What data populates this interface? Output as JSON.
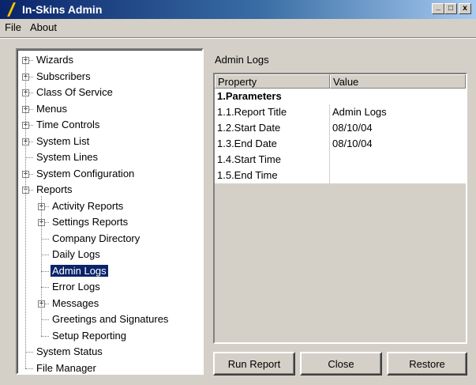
{
  "window": {
    "title": "In-Skins Admin"
  },
  "titlebar_buttons": {
    "minimize": "_",
    "maximize": "□",
    "close": "x"
  },
  "menu": [
    "File",
    "About"
  ],
  "tree": [
    {
      "label": "Wizards",
      "level": 0,
      "expander": "+"
    },
    {
      "label": "Subscribers",
      "level": 0,
      "expander": "+"
    },
    {
      "label": "Class Of Service",
      "level": 0,
      "expander": "+"
    },
    {
      "label": "Menus",
      "level": 0,
      "expander": "+"
    },
    {
      "label": "Time Controls",
      "level": 0,
      "expander": "+"
    },
    {
      "label": "System List",
      "level": 0,
      "expander": "+"
    },
    {
      "label": "System Lines",
      "level": 0,
      "expander": ""
    },
    {
      "label": "System Configuration",
      "level": 0,
      "expander": "+"
    },
    {
      "label": "Reports",
      "level": 0,
      "expander": "-"
    },
    {
      "label": "Activity Reports",
      "level": 1,
      "expander": "+"
    },
    {
      "label": "Settings Reports",
      "level": 1,
      "expander": "+"
    },
    {
      "label": "Company Directory",
      "level": 1,
      "expander": ""
    },
    {
      "label": "Daily Logs",
      "level": 1,
      "expander": ""
    },
    {
      "label": "Admin Logs",
      "level": 1,
      "expander": "",
      "selected": true
    },
    {
      "label": "Error Logs",
      "level": 1,
      "expander": ""
    },
    {
      "label": "Messages",
      "level": 1,
      "expander": "+"
    },
    {
      "label": "Greetings and Signatures",
      "level": 1,
      "expander": ""
    },
    {
      "label": "Setup Reporting",
      "level": 1,
      "expander": ""
    },
    {
      "label": "System Status",
      "level": 0,
      "expander": ""
    },
    {
      "label": "File Manager",
      "level": 0,
      "expander": ""
    }
  ],
  "panel": {
    "title": "Admin Logs",
    "headers": [
      "Property",
      "Value"
    ],
    "category": "1.Parameters",
    "rows": [
      {
        "property": "1.1.Report Title",
        "value": "Admin Logs"
      },
      {
        "property": "1.2.Start Date",
        "value": "08/10/04"
      },
      {
        "property": "1.3.End Date",
        "value": "08/10/04"
      },
      {
        "property": "1.4.Start Time",
        "value": ""
      },
      {
        "property": "1.5.End Time",
        "value": ""
      }
    ]
  },
  "buttons": {
    "run": "Run Report",
    "close": "Close",
    "restore": "Restore"
  },
  "colors": {
    "titlebar_start": "#0a246a",
    "titlebar_end": "#a6caf0",
    "selection": "#0a246a",
    "face": "#d4d0c8"
  }
}
